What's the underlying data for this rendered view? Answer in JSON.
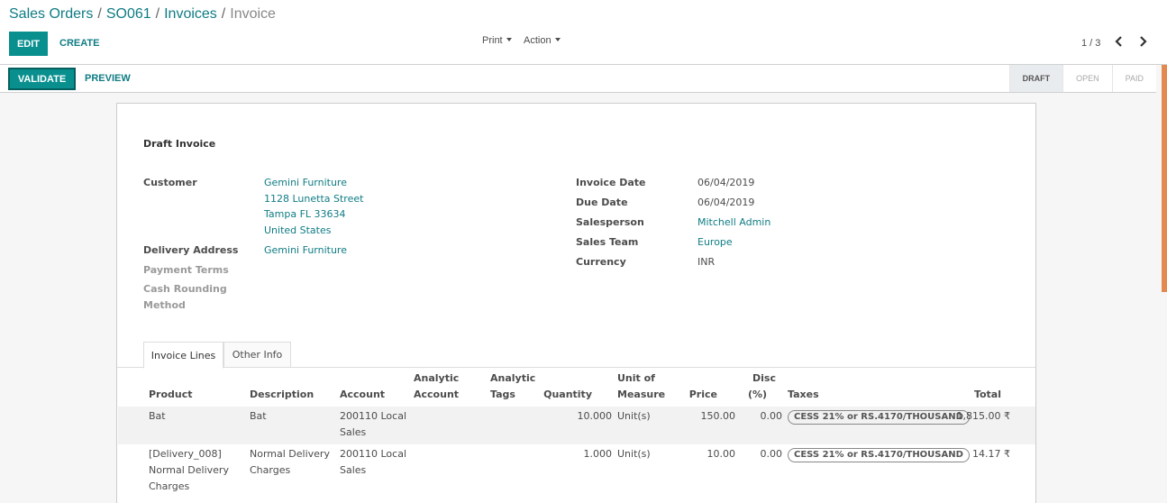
{
  "breadcrumb": {
    "items": [
      "Sales Orders",
      "SO061",
      "Invoices"
    ],
    "current": "Invoice",
    "separator": "/"
  },
  "toolbar": {
    "edit_label": "EDIT",
    "create_label": "CREATE",
    "print_label": "Print",
    "action_label": "Action"
  },
  "pager": {
    "value": "1 / 3",
    "prev_icon": "chevron-left-icon",
    "next_icon": "chevron-right-icon"
  },
  "statusbar": {
    "validate_label": "VALIDATE",
    "preview_label": "PREVIEW",
    "stages": [
      "DRAFT",
      "OPEN",
      "PAID"
    ],
    "active_stage": "DRAFT"
  },
  "invoice": {
    "title": "Draft Invoice",
    "customer_label": "Customer",
    "customer_lines": [
      "Gemini Furniture",
      "1128 Lunetta Street",
      "Tampa FL 33634",
      "United States"
    ],
    "delivery_address_label": "Delivery Address",
    "delivery_address": "Gemini Furniture",
    "payment_terms_label": "Payment Terms",
    "cash_rounding_label_1": "Cash Rounding",
    "cash_rounding_label_2": "Method",
    "invoice_date_label": "Invoice Date",
    "invoice_date": "06/04/2019",
    "due_date_label": "Due Date",
    "due_date": "06/04/2019",
    "salesperson_label": "Salesperson",
    "salesperson": "Mitchell Admin",
    "sales_team_label": "Sales Team",
    "sales_team": "Europe",
    "currency_label": "Currency",
    "currency": "INR"
  },
  "tabs": [
    "Invoice Lines",
    "Other Info"
  ],
  "table": {
    "headers": {
      "product": "Product",
      "description": "Description",
      "account": "Account",
      "analytic_account_1": "Analytic",
      "analytic_account_2": "Account",
      "analytic_tags_1": "Analytic",
      "analytic_tags_2": "Tags",
      "quantity": "Quantity",
      "uom_1": "Unit of",
      "uom_2": "Measure",
      "price": "Price",
      "disc_1": "Disc",
      "disc_2": "(%)",
      "taxes": "Taxes",
      "total": "Total"
    },
    "rows": [
      {
        "product": [
          "Bat"
        ],
        "description": [
          "Bat"
        ],
        "account": [
          "200110 Local",
          "Sales"
        ],
        "quantity": "10.000",
        "uom": "Unit(s)",
        "price": "150.00",
        "disc": "0.00",
        "tax": "CESS 21% or RS.4170/THOUSAND",
        "total": "1,815.00 ₹"
      },
      {
        "product": [
          "[Delivery_008]",
          "Normal Delivery",
          "Charges"
        ],
        "description": [
          "Normal Delivery",
          "Charges"
        ],
        "account": [
          "200110 Local",
          "Sales"
        ],
        "quantity": "1.000",
        "uom": "Unit(s)",
        "price": "10.00",
        "disc": "0.00",
        "tax": "CESS 21% or RS.4170/THOUSAND",
        "total": "14.17 ₹"
      }
    ]
  }
}
